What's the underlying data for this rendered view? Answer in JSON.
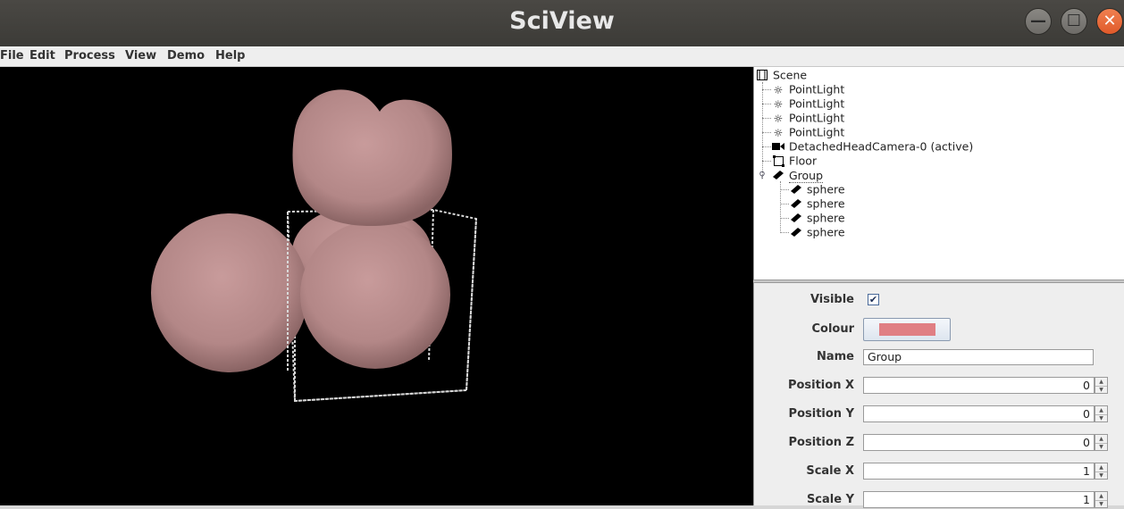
{
  "window": {
    "title": "SciView"
  },
  "window_controls": {
    "minimize": "—",
    "maximize": "☐",
    "close": "✕"
  },
  "menubar": {
    "items": [
      "File",
      "Edit",
      "Process",
      "View",
      "Demo",
      "Help"
    ]
  },
  "tree": {
    "root": "Scene",
    "items": [
      {
        "label": "PointLight",
        "icon": "point-light-icon"
      },
      {
        "label": "PointLight",
        "icon": "point-light-icon"
      },
      {
        "label": "PointLight",
        "icon": "point-light-icon"
      },
      {
        "label": "PointLight",
        "icon": "point-light-icon"
      },
      {
        "label": "DetachedHeadCamera-0 (active)",
        "icon": "camera-icon"
      },
      {
        "label": "Floor",
        "icon": "box-icon"
      },
      {
        "label": "Group",
        "icon": "mesh-icon"
      }
    ],
    "children": [
      {
        "label": "sphere",
        "icon": "mesh-icon"
      },
      {
        "label": "sphere",
        "icon": "mesh-icon"
      },
      {
        "label": "sphere",
        "icon": "mesh-icon"
      },
      {
        "label": "sphere",
        "icon": "mesh-icon"
      }
    ]
  },
  "properties": {
    "visible_label": "Visible",
    "visible_checked": true,
    "colour_label": "Colour",
    "colour_value": "#e07f84",
    "name_label": "Name",
    "name_value": "Group",
    "position_x_label": "Position X",
    "position_x_value": "0",
    "position_y_label": "Position Y",
    "position_y_value": "0",
    "position_z_label": "Position Z",
    "position_z_value": "0",
    "scale_x_label": "Scale X",
    "scale_x_value": "1",
    "scale_y_label": "Scale Y",
    "scale_y_value": "1"
  },
  "colors": {
    "sphere_fill": "#b88a8a",
    "viewport_bg": "#000000",
    "bbox_stroke": "#d8d8d8"
  }
}
